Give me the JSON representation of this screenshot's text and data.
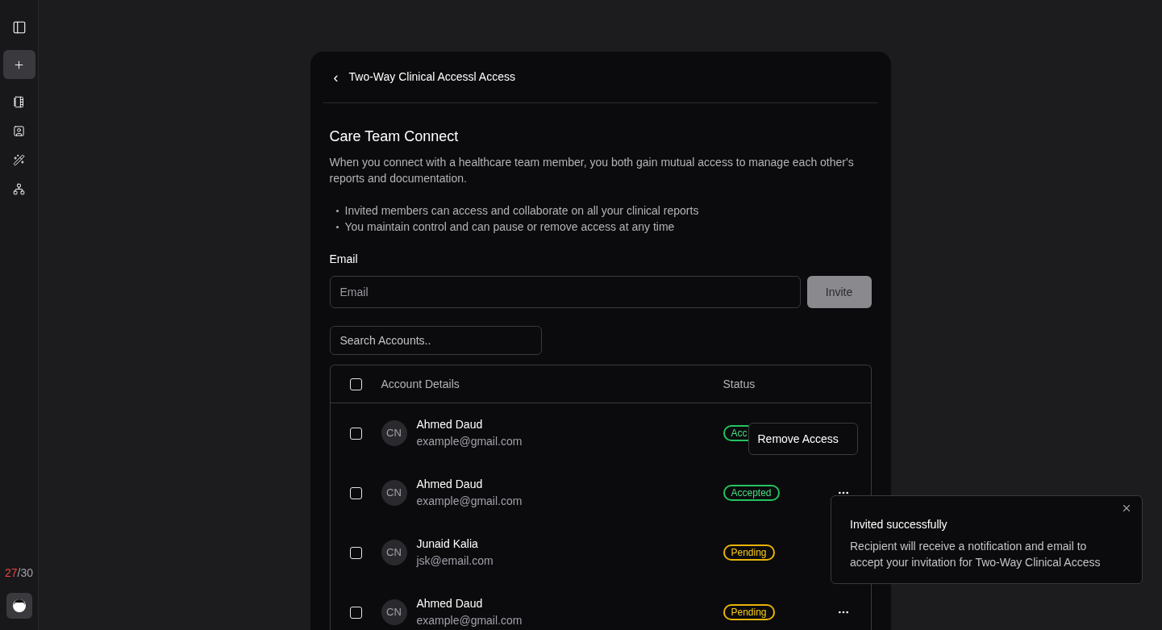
{
  "sidebar": {
    "items": [
      {
        "kind": "panel",
        "selected": false
      },
      {
        "kind": "new",
        "selected": true
      },
      {
        "kind": "notebook",
        "selected": false
      },
      {
        "kind": "contacts",
        "selected": false
      },
      {
        "kind": "wand",
        "selected": false
      },
      {
        "kind": "network",
        "selected": false
      }
    ],
    "usage": {
      "used": "27",
      "rest": "/30"
    }
  },
  "header": {
    "back": "‹",
    "title": "Two-Way Clinical Accessl Access"
  },
  "section": {
    "title": "Care Team Connect",
    "description": "When you connect with a healthcare team member, you both gain mutual access to manage each other's reports and documentation.",
    "bullets": [
      "Invited members can access and collaborate on all your clinical reports",
      "You maintain control and can pause or remove access at any time"
    ]
  },
  "invite": {
    "label": "Email",
    "placeholder": "Email",
    "button": "Invite",
    "disabled": true
  },
  "search": {
    "placeholder": "Search Accounts.."
  },
  "table": {
    "columns": [
      "Account Details",
      "Status"
    ],
    "header_checked": false,
    "rows": [
      {
        "checked": false,
        "initials": "CN",
        "name": "Ahmed Daud",
        "email": "example@gmail.com",
        "status": "Acc",
        "kind": "accepted",
        "actions_visible": false,
        "menu": {
          "items": [
            "Remove Access"
          ]
        }
      },
      {
        "checked": false,
        "initials": "CN",
        "name": "Ahmed Daud",
        "email": "example@gmail.com",
        "status": "Accepted",
        "kind": "accepted",
        "actions_visible": true
      },
      {
        "checked": false,
        "initials": "CN",
        "name": "Junaid Kalia",
        "email": "jsk@email.com",
        "status": "Pending",
        "kind": "pending",
        "actions_visible": false
      },
      {
        "checked": false,
        "initials": "CN",
        "name": "Ahmed Daud",
        "email": "example@gmail.com",
        "status": "Pending",
        "kind": "pending",
        "actions_visible": true
      }
    ]
  },
  "toast": {
    "title": "Invited successfully",
    "message": "Recipient will receive a notification and email to accept your invitation for Two-Way Clinical Access"
  }
}
